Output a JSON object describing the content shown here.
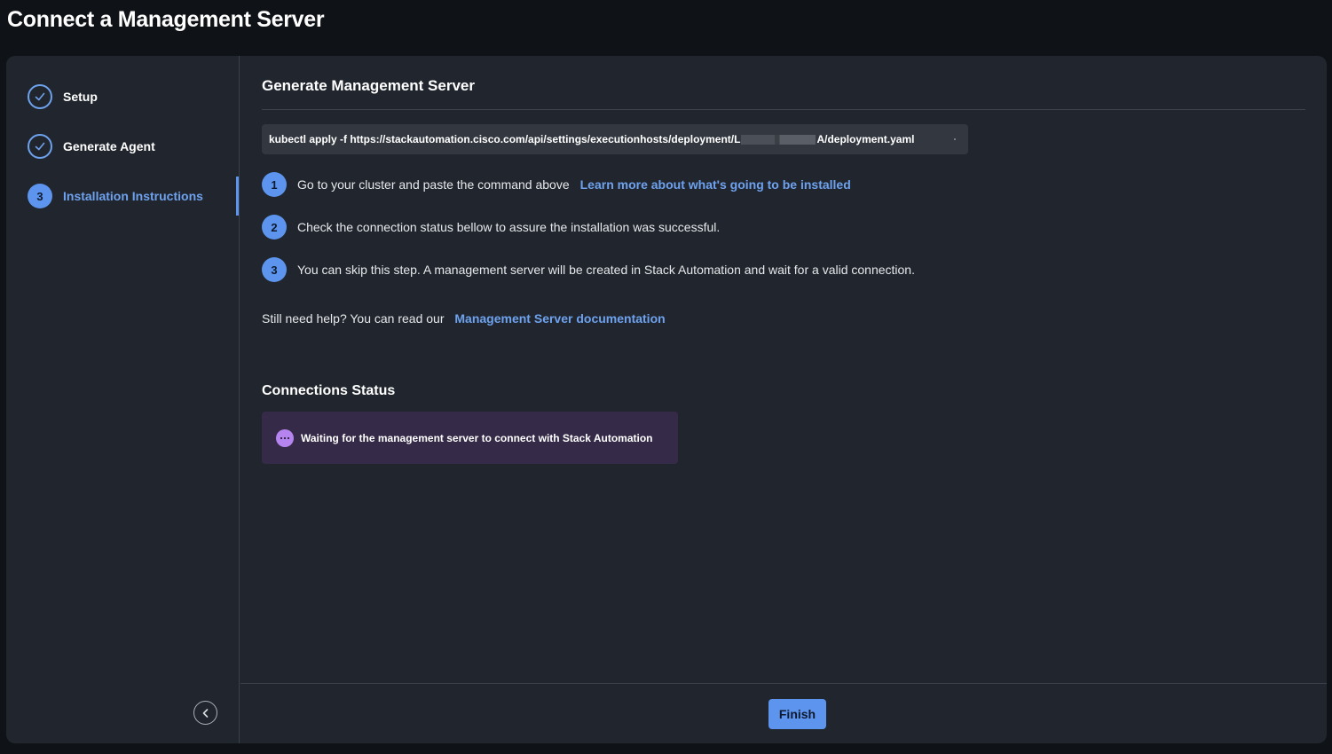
{
  "page": {
    "title": "Connect a Management Server"
  },
  "sidebar": {
    "steps": [
      {
        "label": "Setup",
        "state": "done"
      },
      {
        "label": "Generate Agent",
        "state": "done"
      },
      {
        "label": "Installation Instructions",
        "state": "active",
        "number": "3"
      }
    ]
  },
  "main": {
    "title": "Generate Management Server",
    "command": {
      "prefix": "kubectl apply -f https://stackautomation.cisco.com/api/settings/executionhosts/deployment/L",
      "suffix": "A/deployment.yaml"
    },
    "instructions": [
      {
        "number": "1",
        "text": "Go to your cluster and paste the command above",
        "link": "Learn more about what's going to be installed"
      },
      {
        "number": "2",
        "text": "Check the connection status bellow to assure the installation was successful."
      },
      {
        "number": "3",
        "text": "You can skip this step. A management server will be created in Stack Automation and wait for a valid connection."
      }
    ],
    "help": {
      "text": "Still need help? You can read our",
      "link": "Management Server documentation"
    },
    "connections": {
      "title": "Connections Status",
      "status_text": "Waiting for the management server to connect with Stack Automation"
    }
  },
  "footer": {
    "finish_label": "Finish"
  },
  "colors": {
    "accent": "#5c94ee",
    "link": "#6ea2ee",
    "status_bg": "#352a48",
    "status_icon": "#b684ef"
  }
}
